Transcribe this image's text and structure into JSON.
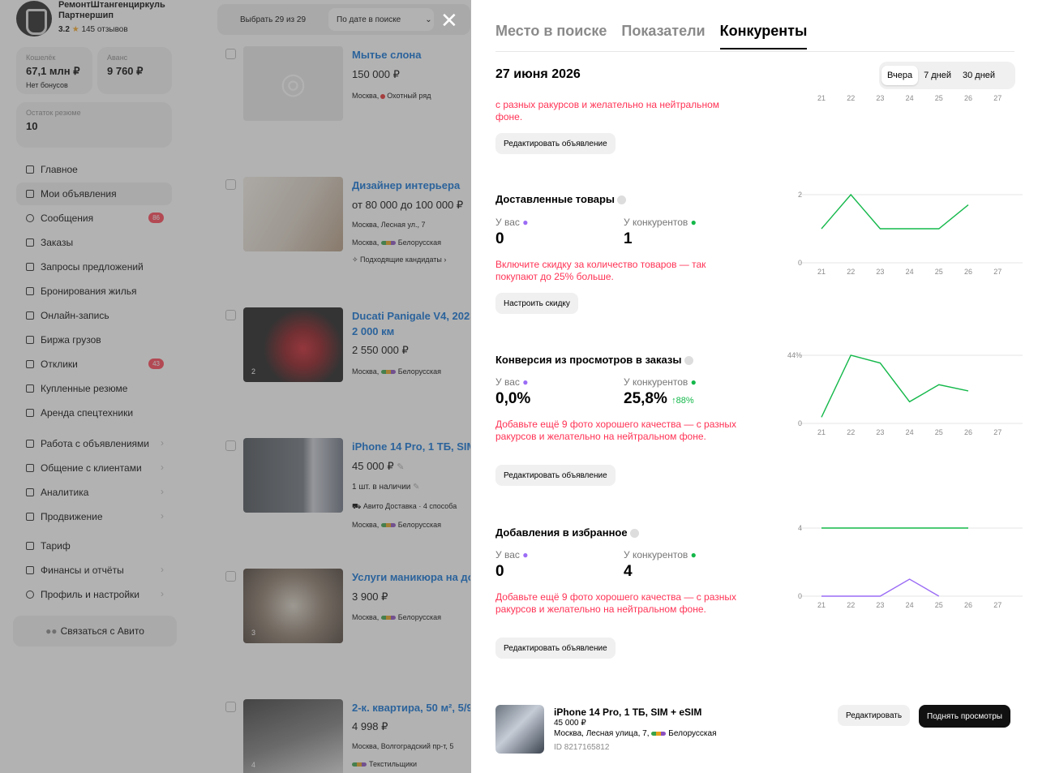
{
  "sidebar": {
    "profile": {
      "name": "РемонтШтангенциркуль Партнершип",
      "rating": "3.2",
      "reviews": "145 отзывов"
    },
    "wallet": {
      "label": "Кошелёк",
      "value": "67,1 млн ₽",
      "sub": "Нет бонусов"
    },
    "advance": {
      "label": "Аванс",
      "value": "9 760 ₽"
    },
    "resumes": {
      "label": "Остаток резюме",
      "value": "10"
    },
    "items": [
      {
        "label": "Главное"
      },
      {
        "label": "Мои объявления"
      },
      {
        "label": "Сообщения",
        "badge": "86"
      },
      {
        "label": "Заказы"
      },
      {
        "label": "Запросы предложений"
      },
      {
        "label": "Бронирования жилья"
      },
      {
        "label": "Онлайн-запись"
      },
      {
        "label": "Биржа грузов"
      },
      {
        "label": "Отклики",
        "badge": "43"
      },
      {
        "label": "Купленные резюме"
      },
      {
        "label": "Аренда спецтехники"
      },
      {
        "label": "Работа с объявлениями"
      },
      {
        "label": "Общение с клиентами"
      },
      {
        "label": "Аналитика"
      },
      {
        "label": "Продвижение"
      },
      {
        "label": "Тариф"
      },
      {
        "label": "Финансы и отчёты"
      },
      {
        "label": "Профиль и настройки"
      }
    ],
    "contact": "Связаться с Авито"
  },
  "listings": {
    "select_all": "Выбрать 29 из 29",
    "sort": "По дате в поиске",
    "items": [
      {
        "title": "Мытье слона",
        "price": "150 000 ₽",
        "meta": "Москва,",
        "metro": "Охотный ряд"
      },
      {
        "title": "Дизайнер интерьера",
        "price": "от 80 000 до 100 000 ₽",
        "meta": "Москва, Лесная ул., 7",
        "metro": "Москва,",
        "station": "Белорусская",
        "extra": "Подходящие кандидаты"
      },
      {
        "title": "Ducati Panigale V4, 2023",
        "title2": "2 000 км",
        "price": "2 550 000 ₽",
        "meta": "Москва,",
        "station": "Белорусская",
        "num": "2"
      },
      {
        "title": "iPhone 14 Pro, 1 ТБ, SIM + eSIM",
        "price": "45 000 ₽",
        "stock": "1 шт. в наличии",
        "delivery": "Авито Доставка · 4 способа",
        "meta": "Москва,",
        "station": "Белорусская"
      },
      {
        "title": "Услуги маникюра на дому",
        "price": "3 900 ₽",
        "meta": "Москва,",
        "station": "Белорусская",
        "num": "3"
      },
      {
        "title": "2-к. квартира, 50 м², 5/9 эт.",
        "price": "4 998 ₽",
        "meta": "Москва, Волгоградский пр-т, 5",
        "station": "Текстильщики",
        "num": "4"
      }
    ]
  },
  "panel": {
    "tabs": [
      "Место в поиске",
      "Показатели",
      "Конкуренты"
    ],
    "date": "27 июня 2026",
    "ranges": [
      "Вчера",
      "7 дней",
      "30 дней"
    ],
    "top_warn": "с разных ракурсов и желательно на нейтральном фоне.",
    "top_btn": "Редактировать объявление",
    "you_label": "У вас",
    "comp_label": "У конкурентов",
    "metrics": [
      {
        "title": "Доставленные товары",
        "you": "0",
        "comp": "1",
        "warn": "Включите скидку за количество товаров — так покупают до 25% больше.",
        "btn": "Настроить скидку"
      },
      {
        "title": "Конверсия из просмотров в заказы",
        "you": "0,0%",
        "comp": "25,8%",
        "growth": "↑88%",
        "warn": "Добавьте ещё 9 фото хорошего качества — с разных ракурсов и желательно на нейтральном фоне.",
        "btn": "Редактировать объявление"
      },
      {
        "title": "Добавления в избранное",
        "you": "0",
        "comp": "4",
        "warn": "Добавьте ещё 9 фото хорошего качества — с разных ракурсов и желательно на нейтральном фоне.",
        "btn": "Редактировать объявление"
      }
    ],
    "footer": {
      "title": "iPhone 14 Pro, 1 ТБ, SIM + eSIM",
      "price": "45 000 ₽",
      "address": "Москва, Лесная улица, 7,",
      "station": "Белорусская",
      "id": "ID 8217165812",
      "edit": "Редактировать",
      "boost": "Поднять просмотры"
    }
  },
  "colors": {
    "accent": "#0a6fd6",
    "warn": "#ff3355",
    "you": "#9b6cf5",
    "competitors": "#14b84a"
  },
  "chart_data": [
    {
      "type": "line",
      "title": "Доставленные товары",
      "x": [
        "21",
        "22",
        "23",
        "24",
        "25",
        "26",
        "27"
      ],
      "ylim": [
        0,
        2
      ],
      "series": [
        {
          "name": "У конкурентов",
          "values": [
            1,
            2,
            1,
            1,
            1,
            1.7,
            null
          ]
        }
      ]
    },
    {
      "type": "line",
      "title": "Конверсия из просмотров в заказы",
      "x": [
        "21",
        "22",
        "23",
        "24",
        "25",
        "26",
        "27"
      ],
      "ylim": [
        0,
        44
      ],
      "ytick_top": "44%",
      "series": [
        {
          "name": "У конкурентов",
          "values": [
            4,
            44,
            39,
            14,
            25,
            21,
            null
          ]
        }
      ]
    },
    {
      "type": "line",
      "title": "Добавления в избранное",
      "x": [
        "21",
        "22",
        "23",
        "24",
        "25",
        "26",
        "27"
      ],
      "ylim": [
        0,
        4
      ],
      "series": [
        {
          "name": "У конкурентов",
          "values": [
            4,
            4,
            4,
            4,
            4,
            4,
            null
          ]
        },
        {
          "name": "У вас",
          "values": [
            0,
            0,
            0,
            1,
            0,
            null,
            null
          ]
        }
      ]
    }
  ]
}
